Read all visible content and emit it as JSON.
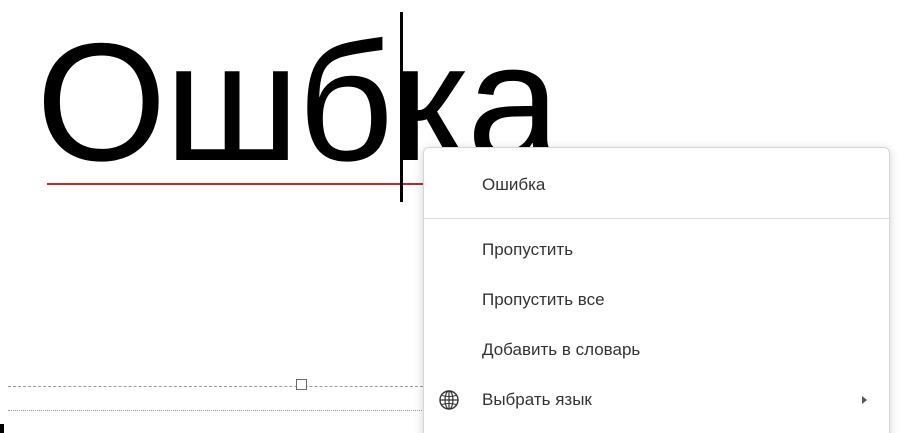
{
  "document": {
    "word": "Ошбка"
  },
  "context_menu": {
    "suggestion": "Ошибка",
    "items": [
      {
        "label": "Пропустить"
      },
      {
        "label": "Пропустить все"
      },
      {
        "label": "Добавить в словарь"
      },
      {
        "label": "Выбрать язык",
        "icon": "globe-icon",
        "has_submenu": true
      }
    ]
  },
  "colors": {
    "spell_underline": "#c0282b",
    "menu_text": "#333333",
    "menu_border": "#d6d6d6"
  }
}
